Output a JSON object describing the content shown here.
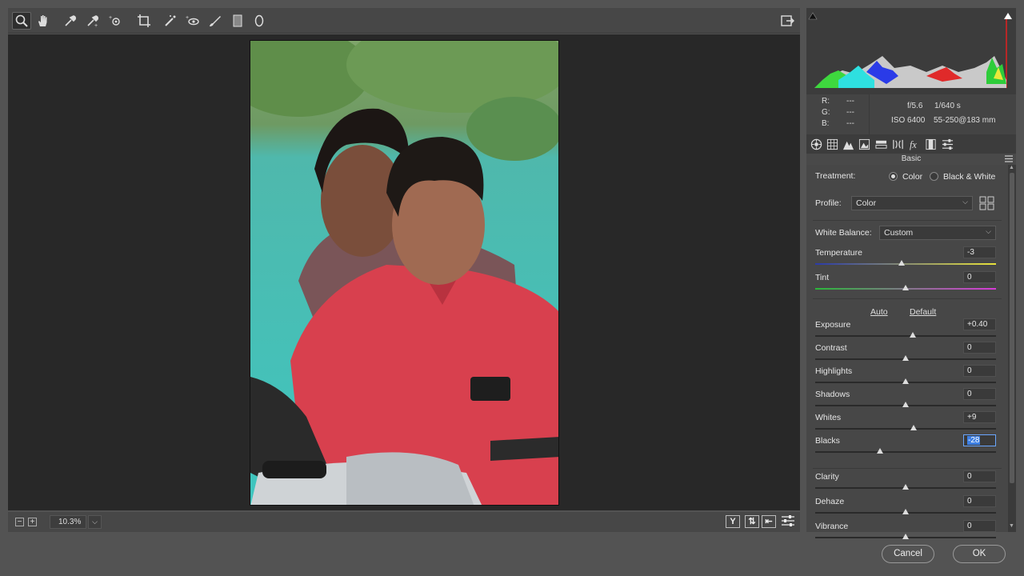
{
  "tools": [
    "zoom-icon",
    "hand-icon",
    "white-balance-icon",
    "color-sampler-icon",
    "target-adjustment-icon",
    "crop-icon",
    "spot-removal-icon",
    "red-eye-icon",
    "adjustment-brush-icon",
    "graduated-filter-icon",
    "radial-filter-icon"
  ],
  "zoom": {
    "value": "10.3%"
  },
  "info": {
    "r_label": "R:",
    "g_label": "G:",
    "b_label": "B:",
    "r_val": "---",
    "g_val": "---",
    "b_val": "---",
    "aperture": "f/5.6",
    "shutter": "1/640 s",
    "iso": "ISO 6400",
    "lens": "55-250@183 mm"
  },
  "panel_title": "Basic",
  "treatment": {
    "label": "Treatment:",
    "opt_color": "Color",
    "opt_bw": "Black & White",
    "selected": "Color"
  },
  "profile": {
    "label": "Profile:",
    "value": "Color"
  },
  "white_balance": {
    "label": "White Balance:",
    "value": "Custom"
  },
  "links": {
    "auto": "Auto",
    "default": "Default"
  },
  "sliders": [
    {
      "label": "Temperature",
      "value": "-3",
      "level": 0.48
    },
    {
      "label": "Tint",
      "value": "0",
      "level": 0.5
    },
    {
      "label": "Exposure",
      "value": "+0.40",
      "level": 0.54
    },
    {
      "label": "Contrast",
      "value": "0",
      "level": 0.5
    },
    {
      "label": "Highlights",
      "value": "0",
      "level": 0.5
    },
    {
      "label": "Shadows",
      "value": "0",
      "level": 0.5
    },
    {
      "label": "Whites",
      "value": "+9",
      "level": 0.545
    },
    {
      "label": "Blacks",
      "value": "-28",
      "level": 0.36
    },
    {
      "label": "Clarity",
      "value": "0",
      "level": 0.5
    },
    {
      "label": "Dehaze",
      "value": "0",
      "level": 0.5
    },
    {
      "label": "Vibrance",
      "value": "0",
      "level": 0.5
    }
  ],
  "buttons": {
    "cancel": "Cancel",
    "ok": "OK"
  },
  "colors": {
    "accent_blue": "#3d7fe3",
    "panel_bg": "#474747",
    "canvas_bg": "#282828"
  }
}
